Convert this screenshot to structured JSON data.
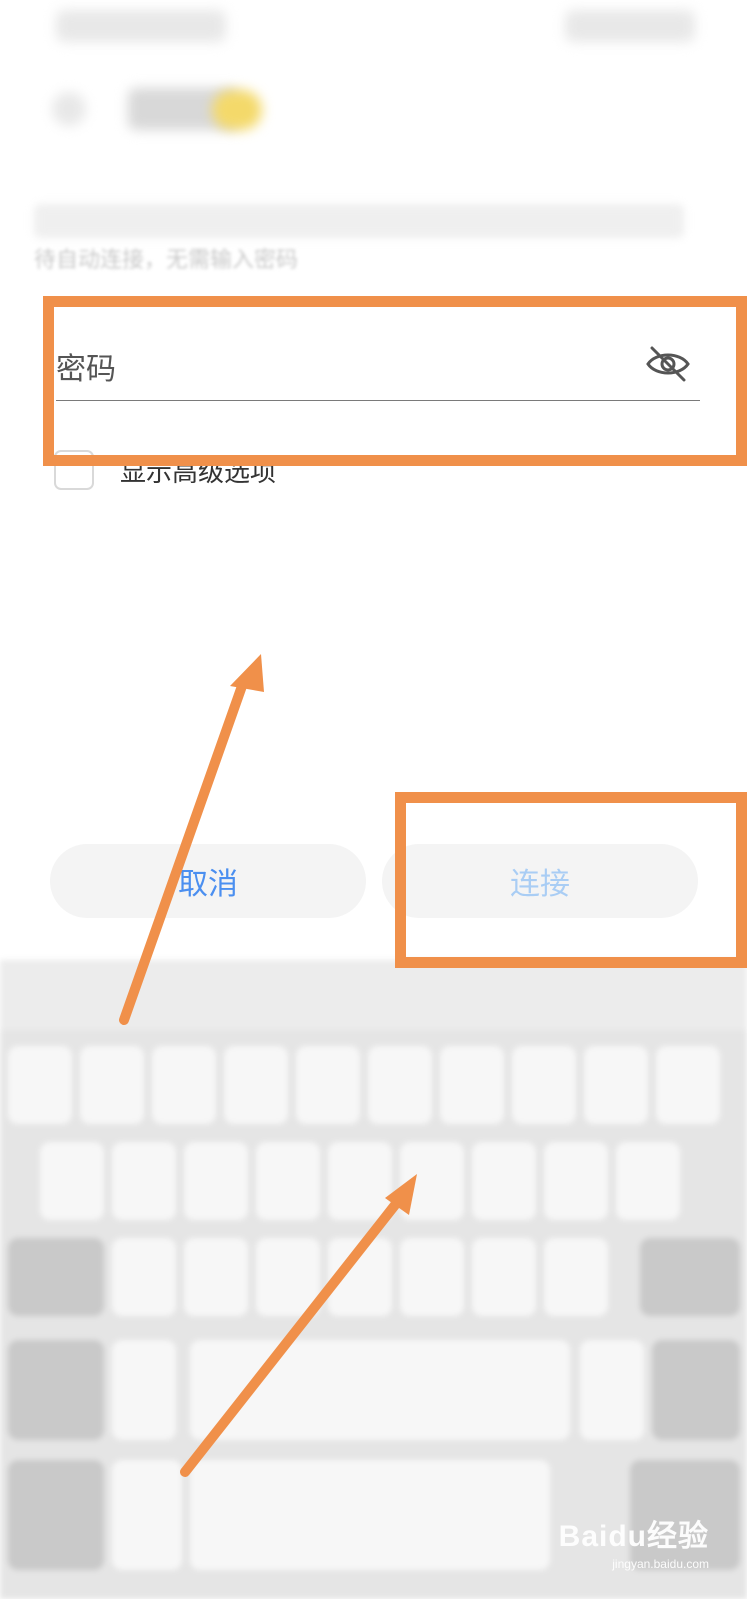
{
  "form": {
    "hint_text": "待自动连接，无需输入密码",
    "password_label": "密码",
    "advanced_label": "显示高级选项"
  },
  "buttons": {
    "cancel": "取消",
    "connect": "连接"
  },
  "watermark": {
    "brand": "Baidu经验",
    "url": "jingyan.baidu.com"
  },
  "colors": {
    "accent_blue": "#4b8ff0",
    "disabled_blue": "#a9cdf4",
    "annotation_orange": "#f0904a"
  },
  "icons": {
    "password_visibility": "eye-off-icon",
    "checkbox": "checkbox-icon"
  }
}
